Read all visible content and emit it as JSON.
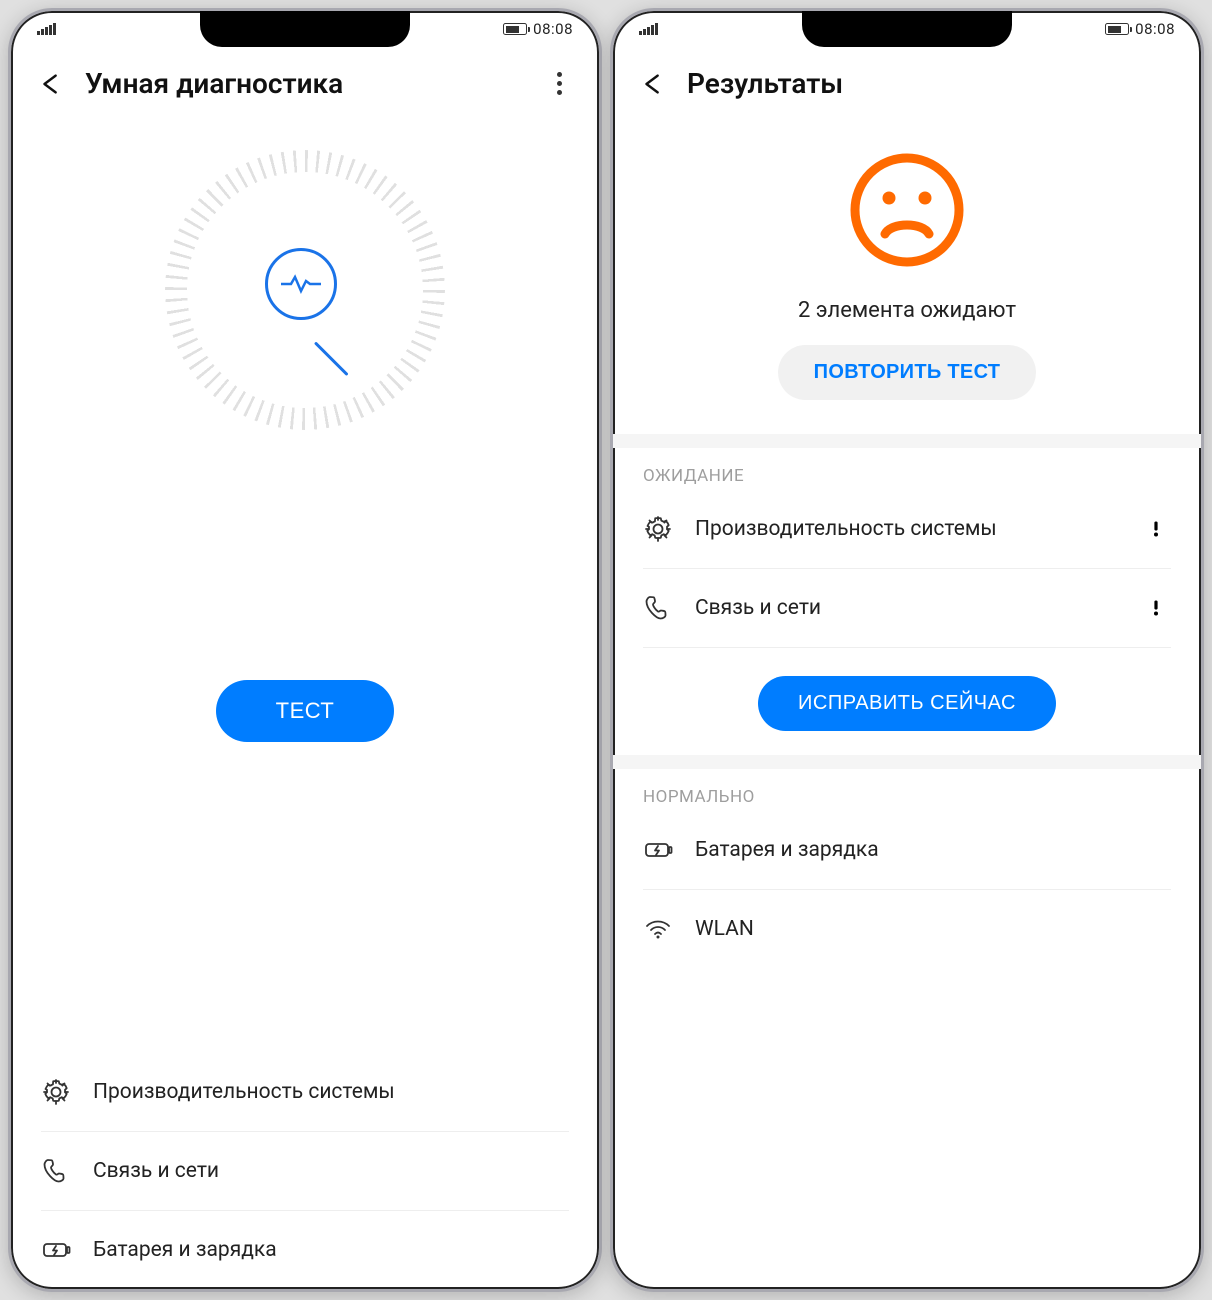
{
  "status_bar": {
    "time": "08:08"
  },
  "colors": {
    "primary": "#007dff",
    "warn": "#ff6a00",
    "ok": "#2ecc40"
  },
  "screen1": {
    "header": {
      "title": "Умная диагностика"
    },
    "test_button": "ТЕСТ",
    "categories": [
      {
        "icon": "gear-icon",
        "label": "Производительность системы"
      },
      {
        "icon": "phone-icon",
        "label": "Связь и сети"
      },
      {
        "icon": "battery-charge-icon",
        "label": "Батарея и зарядка"
      }
    ]
  },
  "screen2": {
    "header": {
      "title": "Результаты"
    },
    "summary_text": "2 элемента ожидают",
    "retry_button": "ПОВТОРИТЬ ТЕСТ",
    "fix_button": "ИСПРАВИТЬ СЕЙЧАС",
    "pending": {
      "title": "ОЖИДАНИЕ",
      "items": [
        {
          "icon": "gear-icon",
          "label": "Производительность системы",
          "status": "warn"
        },
        {
          "icon": "phone-icon",
          "label": "Связь и сети",
          "status": "warn"
        }
      ]
    },
    "normal": {
      "title": "НОРМАЛЬНО",
      "items": [
        {
          "icon": "battery-charge-icon",
          "label": "Батарея и зарядка",
          "status": "ok"
        },
        {
          "icon": "wifi-icon",
          "label": "WLAN",
          "status": "ok"
        }
      ]
    }
  }
}
